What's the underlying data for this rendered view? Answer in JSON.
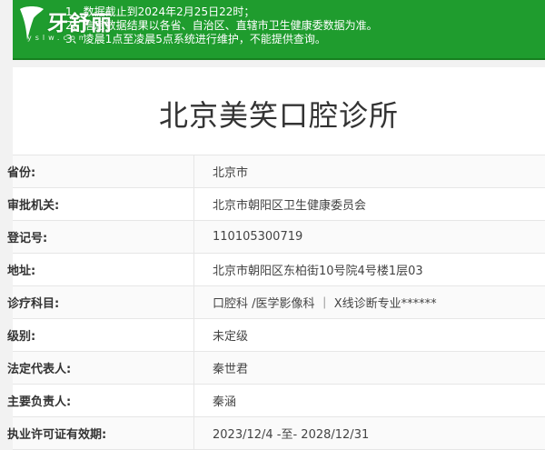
{
  "logo": {
    "brand": "牙舒丽",
    "domain": "yslw.com"
  },
  "notice": {
    "lines": [
      "1、数据截止到2024年2月25日22时；",
      "2、信息数据结果以各省、自治区、直辖市卫生健康委数据为准。",
      "3、凌晨1点至凌晨5点系统进行维护，不能提供查询。"
    ]
  },
  "clinic": {
    "name": "北京美笑口腔诊所"
  },
  "fields": [
    {
      "label": "省份:",
      "value": "北京市"
    },
    {
      "label": "审批机关:",
      "value": "北京市朝阳区卫生健康委员会"
    },
    {
      "label": "登记号:",
      "value": "110105300719"
    },
    {
      "label": "地址:",
      "value": "北京市朝阳区东柏街10号院4号楼1层03"
    },
    {
      "label": "诊疗科目:",
      "value": "口腔科 /医学影像科 ｜ X线诊断专业******"
    },
    {
      "label": "级别:",
      "value": "未定级"
    },
    {
      "label": "法定代表人:",
      "value": "秦世君"
    },
    {
      "label": "主要负责人:",
      "value": "秦涵"
    },
    {
      "label": "执业许可证有效期:",
      "value": "2023/12/4 -至- 2028/12/31"
    }
  ],
  "colors": {
    "notice_bg": "#1f9c2e",
    "text": "#333333",
    "border": "#e6e6e6"
  }
}
